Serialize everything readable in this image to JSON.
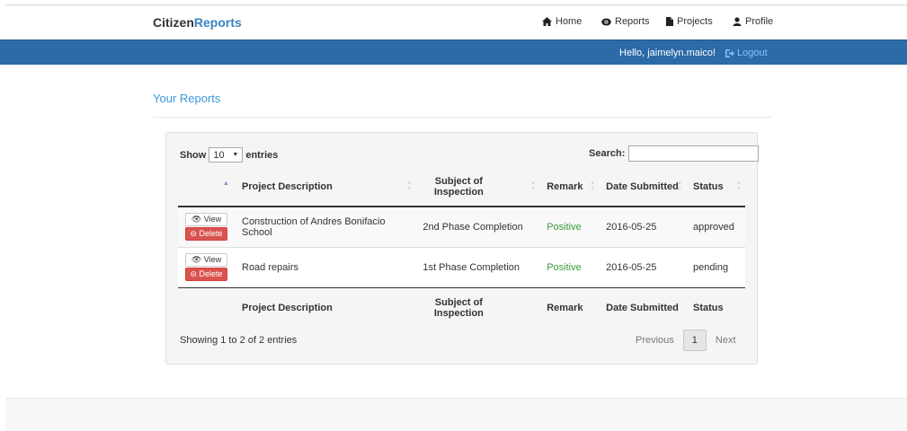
{
  "brand": {
    "part1": "Citizen",
    "part2": "Reports"
  },
  "nav": {
    "home": "Home",
    "reports": "Reports",
    "projects": "Projects",
    "profile": "Profile"
  },
  "userbar": {
    "greeting": "Hello, jaimelyn.maico!",
    "logout": "Logout"
  },
  "page": {
    "title": "Your Reports"
  },
  "table_controls": {
    "show": "Show",
    "entries": "entries",
    "page_size": "10",
    "search_label": "Search:",
    "search_value": ""
  },
  "table": {
    "headers": [
      "",
      "Project Description",
      "Subject of Inspection",
      "Remark",
      "Date Submitted",
      "Status"
    ],
    "rows": [
      {
        "view": "View",
        "delete": "Delete",
        "description": "Construction of Andres Bonifacio School",
        "subject": "2nd Phase Completion",
        "remark": "Positive",
        "date": "2016-05-25",
        "status": "approved"
      },
      {
        "view": "View",
        "delete": "Delete",
        "description": "Road repairs",
        "subject": "1st Phase Completion",
        "remark": "Positive",
        "date": "2016-05-25",
        "status": "pending"
      }
    ]
  },
  "footer_info": "Showing 1 to 2 of 2 entries",
  "pagination": {
    "previous": "Previous",
    "current": "1",
    "next": "Next"
  },
  "colors": {
    "brand_accent": "#3a83c3",
    "navbar_blue": "#2c6aa8",
    "delete_red": "#d9534f",
    "positive_green": "#3c9a3c"
  }
}
